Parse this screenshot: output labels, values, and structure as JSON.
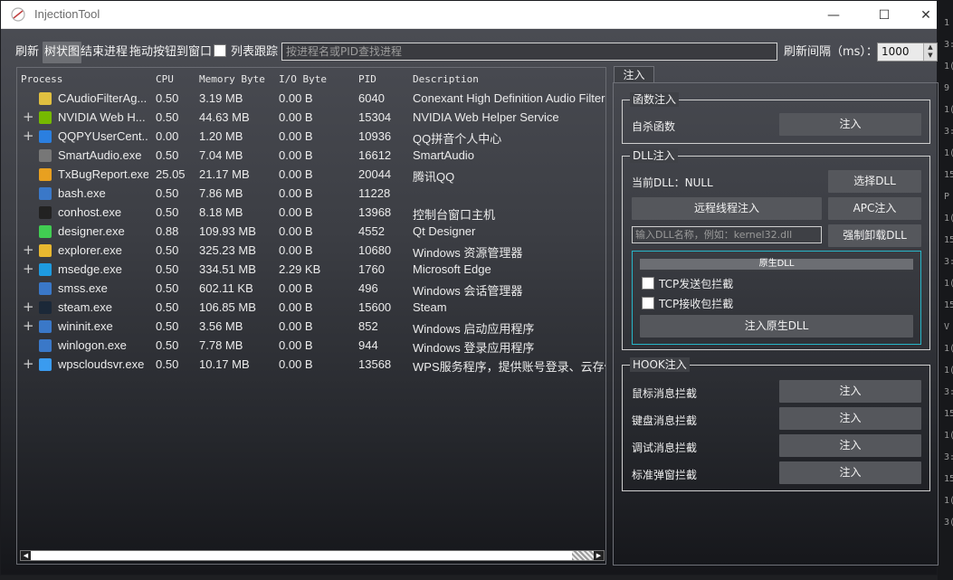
{
  "window": {
    "title": "InjectionTool"
  },
  "titlebar": {
    "minimize": "—",
    "maximize": "☐",
    "close": "✕"
  },
  "toolbar": {
    "refresh": "刷新",
    "tree_view": "树状图",
    "end_process": "结束进程",
    "drag_to_window": "拖动按钮到窗口",
    "list_tracking": "列表跟踪",
    "search_placeholder": "按进程名或PID查找进程",
    "refresh_interval_label": "刷新间隔（ms）：",
    "refresh_interval_value": "1000"
  },
  "tree": {
    "columns": [
      "Process",
      "CPU",
      "Memory Byte",
      "I/O Byte",
      "PID",
      "Description"
    ],
    "rows": [
      {
        "expandable": false,
        "icon": "audio-filter-icon",
        "icon_color": "#e0c040",
        "name": "CAudioFilterAg...",
        "cpu": "0.50",
        "mem": "3.19 MB",
        "io": "0.00 B",
        "pid": "6040",
        "desc": "Conexant High Definition Audio Filter"
      },
      {
        "expandable": true,
        "icon": "nvidia-icon",
        "icon_color": "#76b900",
        "name": "NVIDIA Web H...",
        "cpu": "0.50",
        "mem": "44.63 MB",
        "io": "0.00 B",
        "pid": "15304",
        "desc": "NVIDIA Web Helper Service"
      },
      {
        "expandable": true,
        "icon": "qq-pinyin-icon",
        "icon_color": "#2b7fe0",
        "name": "QQPYUserCent...",
        "cpu": "0.00",
        "mem": "1.20 MB",
        "io": "0.00 B",
        "pid": "10936",
        "desc": "QQ拼音个人中心"
      },
      {
        "expandable": false,
        "icon": "headphones-icon",
        "icon_color": "#777777",
        "name": "SmartAudio.exe",
        "cpu": "0.50",
        "mem": "7.04 MB",
        "io": "0.00 B",
        "pid": "16612",
        "desc": "SmartAudio"
      },
      {
        "expandable": false,
        "icon": "qq-penguin-icon",
        "icon_color": "#e8a020",
        "name": "TxBugReport.exe",
        "cpu": "25.05",
        "mem": "21.17 MB",
        "io": "0.00 B",
        "pid": "20044",
        "desc": "腾讯QQ"
      },
      {
        "expandable": false,
        "icon": "window-app-icon",
        "icon_color": "#3a78c8",
        "name": "bash.exe",
        "cpu": "0.50",
        "mem": "7.86 MB",
        "io": "0.00 B",
        "pid": "11228",
        "desc": ""
      },
      {
        "expandable": false,
        "icon": "console-icon",
        "icon_color": "#222222",
        "name": "conhost.exe",
        "cpu": "0.50",
        "mem": "8.18 MB",
        "io": "0.00 B",
        "pid": "13968",
        "desc": "控制台窗口主机"
      },
      {
        "expandable": false,
        "icon": "qt-designer-icon",
        "icon_color": "#41cd52",
        "name": "designer.exe",
        "cpu": "0.88",
        "mem": "109.93 MB",
        "io": "0.00 B",
        "pid": "4552",
        "desc": "Qt Designer"
      },
      {
        "expandable": true,
        "icon": "folder-icon",
        "icon_color": "#e8b830",
        "name": "explorer.exe",
        "cpu": "0.50",
        "mem": "325.23 MB",
        "io": "0.00 B",
        "pid": "10680",
        "desc": "Windows 资源管理器"
      },
      {
        "expandable": true,
        "icon": "edge-icon",
        "icon_color": "#1e9be0",
        "name": "msedge.exe",
        "cpu": "0.50",
        "mem": "334.51 MB",
        "io": "2.29 KB",
        "pid": "1760",
        "desc": "Microsoft Edge"
      },
      {
        "expandable": false,
        "icon": "window-app-icon",
        "icon_color": "#3a78c8",
        "name": "smss.exe",
        "cpu": "0.50",
        "mem": "602.11 KB",
        "io": "0.00 B",
        "pid": "496",
        "desc": "Windows 会话管理器"
      },
      {
        "expandable": true,
        "icon": "steam-icon",
        "icon_color": "#1b2838",
        "name": "steam.exe",
        "cpu": "0.50",
        "mem": "106.85 MB",
        "io": "0.00 B",
        "pid": "15600",
        "desc": "Steam"
      },
      {
        "expandable": true,
        "icon": "window-app-icon",
        "icon_color": "#3a78c8",
        "name": "wininit.exe",
        "cpu": "0.50",
        "mem": "3.56 MB",
        "io": "0.00 B",
        "pid": "852",
        "desc": "Windows 启动应用程序"
      },
      {
        "expandable": false,
        "icon": "window-app-icon",
        "icon_color": "#3a78c8",
        "name": "winlogon.exe",
        "cpu": "0.50",
        "mem": "7.78 MB",
        "io": "0.00 B",
        "pid": "944",
        "desc": "Windows 登录应用程序"
      },
      {
        "expandable": true,
        "icon": "cloud-icon",
        "icon_color": "#3a9bef",
        "name": "wpscloudsvr.exe",
        "cpu": "0.50",
        "mem": "10.17 MB",
        "io": "0.00 B",
        "pid": "13568",
        "desc": "WPS服务程序，提供账号登录、云存储等"
      }
    ]
  },
  "panel": {
    "tab": "注入",
    "func_group": {
      "title": "函数注入",
      "label": "自杀函数",
      "button": "注入"
    },
    "dll_group": {
      "title": "DLL注入",
      "current_label": "当前DLL：NULL",
      "select_button": "选择DLL",
      "remote_thread_button": "远程线程注入",
      "apc_button": "APC注入",
      "input_placeholder": "输入DLL名称，例如：kernel32.dll",
      "force_unload_button": "强制卸载DLL",
      "native": {
        "title": "原生DLL",
        "tcp_send": "TCP发送包拦截",
        "tcp_recv": "TCP接收包拦截",
        "inject_button": "注入原生DLL"
      }
    },
    "hook_group": {
      "title": "HOOK注入",
      "items": [
        {
          "label": "鼠标消息拦截",
          "button": "注入"
        },
        {
          "label": "键盘消息拦截",
          "button": "注入"
        },
        {
          "label": "调试消息拦截",
          "button": "注入"
        },
        {
          "label": "标准弹窗拦截",
          "button": "注入"
        }
      ]
    }
  },
  "desktop_strip": [
    "1",
    "3:",
    "1(",
    "9",
    "1(",
    "3:",
    "1(",
    "15",
    "P",
    "1(",
    "15",
    "3:",
    "1(",
    "15",
    "V",
    "1(",
    "1(",
    "3:",
    "15",
    "1(",
    "3:",
    "15",
    "1(",
    "3("
  ]
}
